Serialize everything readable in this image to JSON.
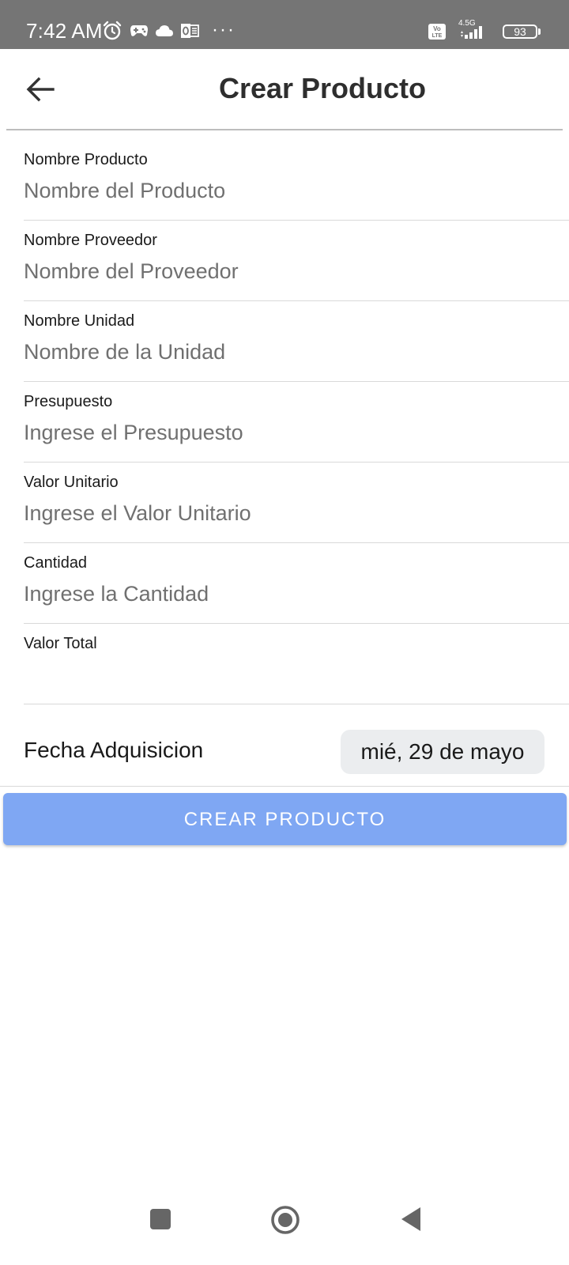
{
  "status_bar": {
    "time": "7:42 AM",
    "icons": [
      "alarm-icon",
      "gamepad-icon",
      "cloud-icon",
      "outlook-icon",
      "more-dots-icon",
      "volte-icon",
      "signal-icon",
      "battery-icon"
    ],
    "dots": "···",
    "volte": "Vo LTE",
    "network": "4.5G",
    "battery": "93"
  },
  "app_bar": {
    "back_icon": "arrow-left-icon",
    "title": "Crear Producto"
  },
  "form": {
    "fields": [
      {
        "label": "Nombre Producto",
        "placeholder": "Nombre del Producto",
        "value": ""
      },
      {
        "label": "Nombre Proveedor",
        "placeholder": "Nombre del Proveedor",
        "value": ""
      },
      {
        "label": "Nombre Unidad",
        "placeholder": "Nombre de la Unidad",
        "value": ""
      },
      {
        "label": "Presupuesto",
        "placeholder": "Ingrese el Presupuesto",
        "value": ""
      },
      {
        "label": "Valor Unitario",
        "placeholder": "Ingrese el Valor Unitario",
        "value": ""
      },
      {
        "label": "Cantidad",
        "placeholder": "Ingrese la Cantidad",
        "value": ""
      },
      {
        "label": "Valor Total",
        "placeholder": "",
        "value": ""
      }
    ],
    "date_label": "Fecha Adquisicion",
    "date_value": "mié, 29 de mayo",
    "submit_label": "CREAR PRODUCTO"
  },
  "nav_bar": {
    "icons": [
      "square-icon",
      "circle-home-icon",
      "triangle-back-icon"
    ]
  },
  "colors": {
    "status_bar_bg": "#757575",
    "button_bg": "#7fa7f3",
    "chip_bg": "#ebedef",
    "divider": "#d9d9d9"
  }
}
